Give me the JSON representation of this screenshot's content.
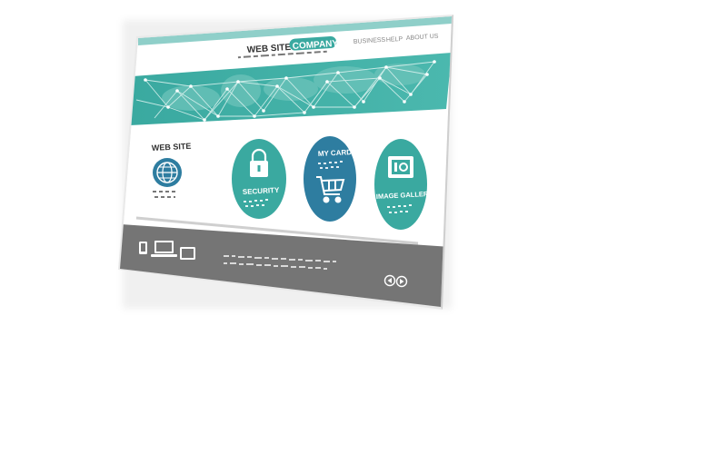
{
  "header": {
    "brand_prefix": "WEB SITE",
    "brand_highlight": "COMPANY",
    "nav": [
      "BUSINESS",
      "HELP",
      "ABOUT US"
    ]
  },
  "intro": {
    "title": "WEB SITE",
    "icon": "globe-icon"
  },
  "features": [
    {
      "label": "SECURITY",
      "icon": "padlock-icon"
    },
    {
      "label": "MY CARD",
      "icon": "shopping-cart-icon"
    },
    {
      "label": "IMAGE GALLERY",
      "icon": "photo-frame-icon"
    }
  ],
  "footer": {
    "devices": [
      "phone-icon",
      "laptop-icon",
      "tablet-icon"
    ],
    "pager": [
      "previous-arrow-icon",
      "next-arrow-icon"
    ]
  },
  "colors": {
    "teal": "#3aa9a0",
    "teal_dark": "#2f8f88",
    "blue": "#2e7da0",
    "footer_gray": "#757575",
    "white": "#ffffff"
  }
}
